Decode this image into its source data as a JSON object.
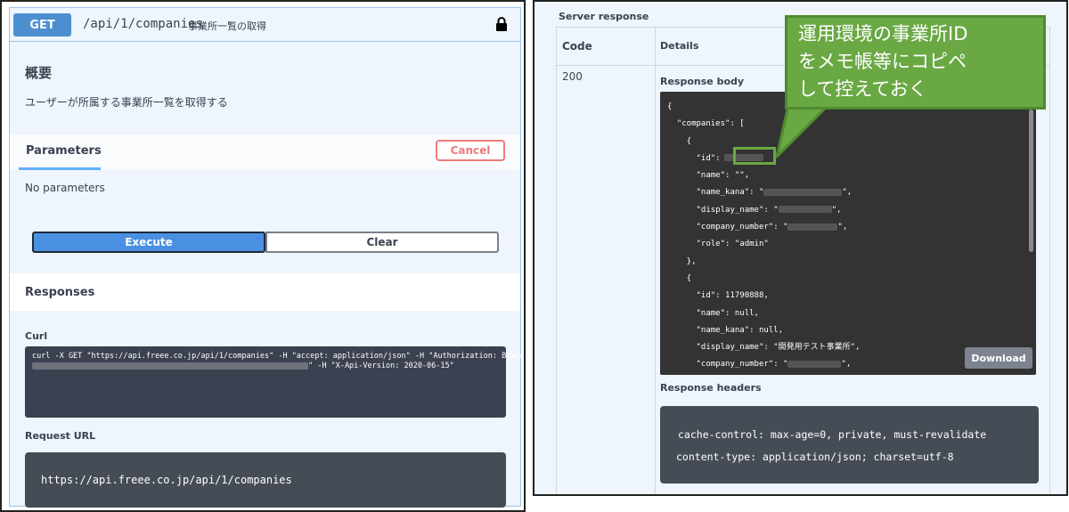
{
  "operation": {
    "method": "GET",
    "path": "/api/1/companies",
    "summary": "事業所一覧の取得"
  },
  "overview": {
    "title": "概要",
    "description": "ユーザーが所属する事業所一覧を取得する"
  },
  "parameters": {
    "tab_label": "Parameters",
    "cancel_label": "Cancel",
    "empty_text": "No parameters"
  },
  "actions": {
    "execute_label": "Execute",
    "clear_label": "Clear"
  },
  "responses": {
    "title": "Responses",
    "curl_label": "Curl",
    "curl_line1": "curl -X GET \"https://api.freee.co.jp/api/1/companies\" -H \"accept: application/json\" -H \"Authorization: Bearer",
    "curl_line2_suffix": "\" -H \"X-Api-Version: 2020-06-15\"",
    "request_url_label": "Request URL",
    "request_url": "https://api.freee.co.jp/api/1/companies"
  },
  "server_response": {
    "label": "Server response",
    "col_code": "Code",
    "col_details": "Details",
    "code": "200",
    "body_label": "Response body",
    "body_lines": [
      "{",
      "  \"companies\": [",
      "    {",
      "      \"id\":",
      "      \"name\": \"\",",
      "      \"name_kana\": \"",
      "      \"display_name\": \"",
      "      \"company_number\": \"",
      "      \"role\": \"admin\"",
      "    },",
      "    {",
      "      \"id\": 11790888,",
      "      \"name\": null,",
      "      \"name_kana\": null,",
      "      \"display_name\": \"開発用テスト事業所\",",
      "      \"company_number\": \""
    ],
    "download_label": "Download",
    "headers_label": "Response headers",
    "headers_lines": [
      "cache-control: max-age=0, private, must-revalidate",
      "content-type: application/json; charset=utf-8"
    ]
  },
  "callout": {
    "lines": [
      "運用環境の事業所ID",
      "をメモ帳等にコピペ",
      "して控えておく"
    ]
  },
  "colors": {
    "get_badge": "#4b8fd0",
    "execute": "#4a90e2",
    "cancel": "#f27a7a",
    "callout": "#6aa844",
    "code_bg": "#333333"
  }
}
